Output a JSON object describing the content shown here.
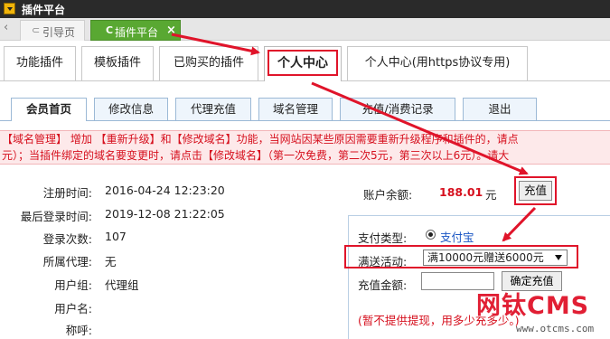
{
  "window": {
    "title": "插件平台"
  },
  "tabbar": {
    "tabs": [
      {
        "label": "引导页"
      },
      {
        "label": "插件平台"
      }
    ]
  },
  "main_tabs": [
    {
      "label": "功能插件"
    },
    {
      "label": "模板插件"
    },
    {
      "label": "已购买的插件"
    },
    {
      "label": "个人中心"
    },
    {
      "label": "个人中心(用https协议专用)"
    }
  ],
  "sub_tabs": [
    {
      "label": "会员首页"
    },
    {
      "label": "修改信息"
    },
    {
      "label": "代理充值"
    },
    {
      "label": "域名管理"
    },
    {
      "label": "充值/消费记录"
    },
    {
      "label": "退出"
    }
  ],
  "notice": {
    "line1": "【域名管理】 增加 【重新升级】和【修改域名】功能，当网站因某些原因需要重新升级程序和插件的，请点",
    "line2": "元）；当插件绑定的域名要变更时，请点击【修改域名】（第一次免费，第二次5元，第三次以上6元）。请大"
  },
  "member_info": [
    {
      "label": "注册时间:",
      "value": "2016-04-24 12:23:20"
    },
    {
      "label": "最后登录时间:",
      "value": "2019-12-08 21:22:05"
    },
    {
      "label": "登录次数:",
      "value": "107"
    },
    {
      "label": "所属代理:",
      "value": "无"
    },
    {
      "label": "用户组:",
      "value": "代理组"
    },
    {
      "label": "用户名:",
      "value": ""
    },
    {
      "label": "称呼:",
      "value": ""
    }
  ],
  "balance": {
    "label": "账户余额:",
    "value": "188.01",
    "unit": "元",
    "recharge_button": "充值"
  },
  "recharge_panel": {
    "pay_type_label": "支付类型:",
    "pay_type_option": "支付宝",
    "promo_label": "满送活动:",
    "promo_selected": "满10000元赠送6000元",
    "amount_label": "充值金额:",
    "amount_value": "",
    "confirm_button": "确定充值",
    "hint": "(暂不提供提现，用多少充多少。)"
  },
  "watermark": {
    "brand": "网钛CMS",
    "url": "www.otcms.com"
  },
  "colors": {
    "accent_red": "#e0142a",
    "tab_green": "#59a832",
    "notice_bg": "#fde9ea",
    "link_blue": "#1a56c4"
  },
  "icons": [
    "app-icon",
    "document-icon",
    "close-icon",
    "radio-selected-icon",
    "dropdown-arrow-icon"
  ]
}
